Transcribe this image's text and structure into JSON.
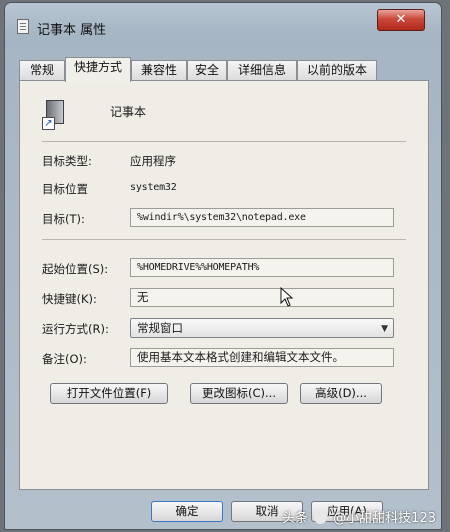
{
  "window": {
    "title": "记事本 属性",
    "close_label": "✕"
  },
  "tabs": [
    {
      "label": "常规"
    },
    {
      "label": "快捷方式"
    },
    {
      "label": "兼容性"
    },
    {
      "label": "安全"
    },
    {
      "label": "详细信息"
    },
    {
      "label": "以前的版本"
    }
  ],
  "app": {
    "name": "记事本"
  },
  "fields": {
    "target_type": {
      "label": "目标类型:",
      "value": "应用程序"
    },
    "target_location": {
      "label": "目标位置",
      "value": "system32"
    },
    "target": {
      "label": "目标(T):",
      "value": "%windir%\\system32\\notepad.exe"
    },
    "start_in": {
      "label": "起始位置(S):",
      "value": "%HOMEDRIVE%%HOMEPATH%"
    },
    "shortcut_key": {
      "label": "快捷键(K):",
      "value": "无"
    },
    "run": {
      "label": "运行方式(R):",
      "value": "常规窗口"
    },
    "comment": {
      "label": "备注(O):",
      "value": "使用基本文本格式创建和编辑文本文件。"
    }
  },
  "buttons": {
    "open_location": "打开文件位置(F)",
    "change_icon": "更改图标(C)...",
    "advanced": "高级(D)...",
    "ok": "确定",
    "cancel": "取消",
    "apply": "应用(A)"
  },
  "watermark": {
    "prefix": "头条",
    "handle": "@小甜甜科技123"
  }
}
